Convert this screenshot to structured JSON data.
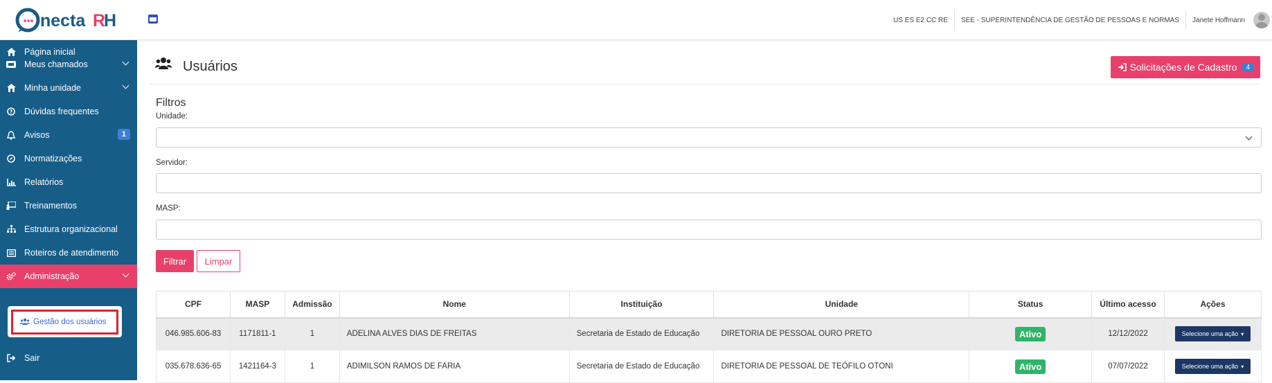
{
  "header": {
    "logo_text": "ConectaRH",
    "user_code": "US ES E2 CC RE",
    "organization": "SEE - SUPERINTENDÊNCIA DE GESTÃO DE PESSOAS E NORMAS",
    "user_name": "Janete Hoffmann",
    "menu_icon": "menu-icon"
  },
  "sidebar": {
    "items": [
      {
        "label": "Página inicial",
        "icon": "home-icon",
        "chevron": false
      },
      {
        "label": "Meus chamados",
        "icon": "ticket-icon",
        "chevron": true
      },
      {
        "label": "Minha unidade",
        "icon": "building-icon",
        "chevron": true
      },
      {
        "label": "Dúvidas frequentes",
        "icon": "question-icon",
        "chevron": false
      },
      {
        "label": "Avisos",
        "icon": "bell-icon",
        "chevron": false,
        "badge": "1"
      },
      {
        "label": "Normatizações",
        "icon": "compass-icon",
        "chevron": false
      },
      {
        "label": "Relatórios",
        "icon": "chart-icon",
        "chevron": false
      },
      {
        "label": "Treinamentos",
        "icon": "presentation-icon",
        "chevron": false
      },
      {
        "label": "Estrutura organizacional",
        "icon": "sitemap-icon",
        "chevron": false
      },
      {
        "label": "Roteiros de atendimento",
        "icon": "list-icon",
        "chevron": false
      },
      {
        "label": "Administração",
        "icon": "cogs-icon",
        "chevron": true,
        "active": true
      },
      {
        "label": "Sair",
        "icon": "sign-out-icon",
        "chevron": false
      }
    ],
    "submenu": {
      "label": "Gestão dos usuários",
      "icon": "users-icon"
    }
  },
  "page": {
    "title": "Usuários",
    "title_icon": "users-icon",
    "solicitacoes_button": "Solicitações de Cadastro",
    "solicitacoes_count": "4",
    "filters_title": "Filtros",
    "unidade_label": "Unidade:",
    "unidade_value": "",
    "servidor_label": "Servidor:",
    "servidor_value": "",
    "masp_label": "MASP:",
    "masp_value": "",
    "filter_button": "Filtrar",
    "clear_button": "Limpar"
  },
  "table": {
    "headers": [
      "CPF",
      "MASP",
      "Admissão",
      "Nome",
      "Instituição",
      "Unidade",
      "Status",
      "Último acesso",
      "Ações"
    ],
    "rows": [
      {
        "cpf": "046.985.606-83",
        "masp": "1171811-1",
        "admissao": "1",
        "nome": "ADELINA ALVES DIAS DE FREITAS",
        "instituicao": "Secretaria de Estado de Educação",
        "unidade": "DIRETORIA DE PESSOAL OURO PRETO",
        "status": "Ativo",
        "ultimo_acesso": "12/12/2022",
        "acao": "Selecione uma ação"
      },
      {
        "cpf": "035.678.636-65",
        "masp": "1421164-3",
        "admissao": "1",
        "nome": "ADIMILSON RAMOS DE FARIA",
        "instituicao": "Secretaria de Estado de Educação",
        "unidade": "DIRETORIA DE PESSOAL DE TEÓFILO OTONI",
        "status": "Ativo",
        "ultimo_acesso": "07/07/2022",
        "acao": "Selecione uma ação"
      }
    ]
  },
  "colors": {
    "sidebar": "#165d88",
    "accent": "#e8406b",
    "badge": "#3d7fd6",
    "status_active": "#2fb46a",
    "action_button": "#1c3764"
  }
}
